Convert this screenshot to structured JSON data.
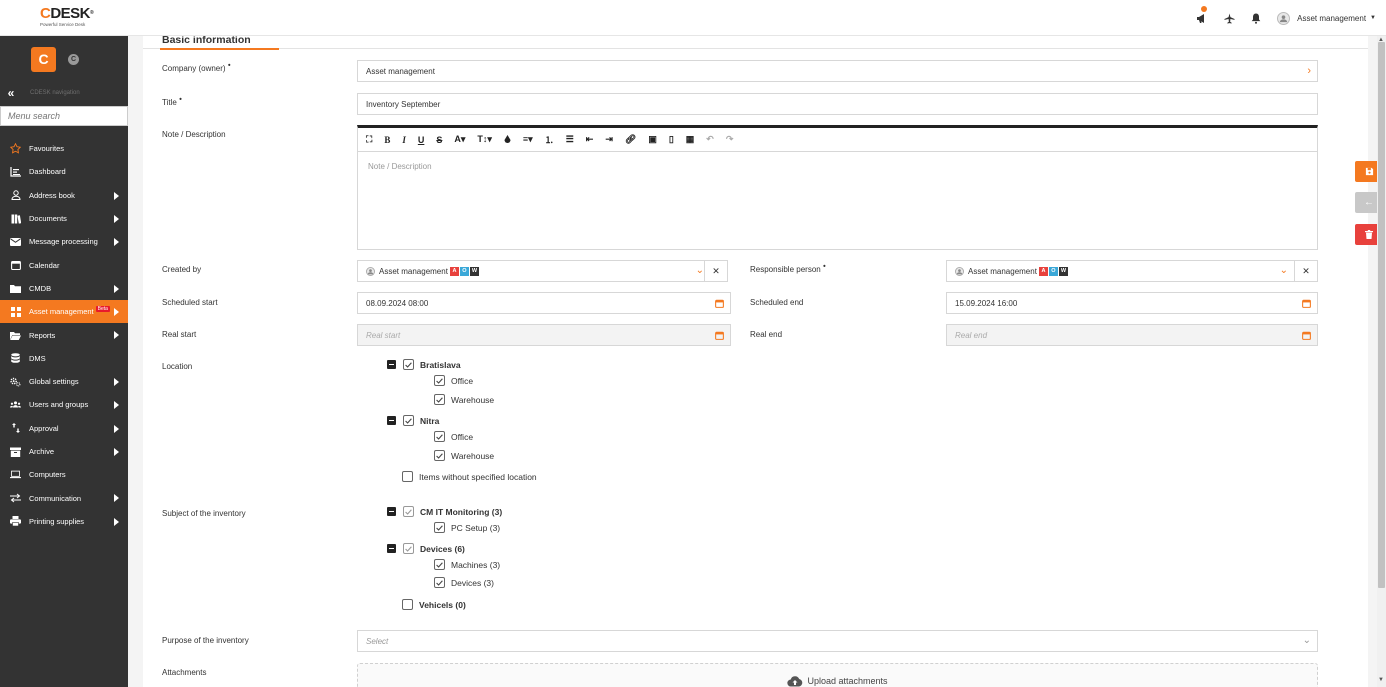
{
  "app": {
    "logo_text": "CDESK",
    "logo_sub": "Powerful Service Desk"
  },
  "topbar": {
    "user_name": "Asset management",
    "icons": [
      "megaphone-icon",
      "airplane-icon",
      "bell-icon",
      "user-avatar-icon"
    ]
  },
  "sidebar": {
    "nav_label": "CDESK navigation",
    "search_placeholder": "Menu search",
    "items": [
      {
        "label": "Favourites",
        "icon": "star-icon",
        "arrow": false
      },
      {
        "label": "Dashboard",
        "icon": "dashboard-icon",
        "arrow": false
      },
      {
        "label": "Address book",
        "icon": "person-icon",
        "arrow": true
      },
      {
        "label": "Documents",
        "icon": "books-icon",
        "arrow": true
      },
      {
        "label": "Message processing",
        "icon": "envelope-icon",
        "arrow": true
      },
      {
        "label": "Calendar",
        "icon": "calendar-icon",
        "arrow": false
      },
      {
        "label": "CMDB",
        "icon": "folder-icon",
        "arrow": true
      },
      {
        "label": "Asset management",
        "icon": "grid-icon",
        "arrow": true,
        "active": true,
        "badge": "Beta"
      },
      {
        "label": "Reports",
        "icon": "folder-open-icon",
        "arrow": true
      },
      {
        "label": "DMS",
        "icon": "database-icon",
        "arrow": false
      },
      {
        "label": "Global settings",
        "icon": "cogs-icon",
        "arrow": true
      },
      {
        "label": "Users and groups",
        "icon": "users-icon",
        "arrow": true
      },
      {
        "label": "Approval",
        "icon": "arrows-icon",
        "arrow": true
      },
      {
        "label": "Archive",
        "icon": "archive-icon",
        "arrow": true
      },
      {
        "label": "Computers",
        "icon": "laptop-icon",
        "arrow": false
      },
      {
        "label": "Communication",
        "icon": "exchange-icon",
        "arrow": true
      },
      {
        "label": "Printing supplies",
        "icon": "printer-icon",
        "arrow": true
      }
    ]
  },
  "form": {
    "section_title": "Basic information",
    "company_label": "Company (owner)",
    "company_value": "Asset management",
    "title_label": "Title",
    "title_value": "Inventory September",
    "note_label": "Note / Description",
    "note_placeholder": "Note / Description",
    "created_by_label": "Created by",
    "created_by_value": "Asset management",
    "responsible_label": "Responsible person",
    "responsible_value": "Asset management",
    "badges": [
      "A",
      "O",
      "W"
    ],
    "scheduled_start_label": "Scheduled start",
    "scheduled_start_value": "08.09.2024 08:00",
    "scheduled_end_label": "Scheduled end",
    "scheduled_end_value": "15.09.2024 16:00",
    "real_start_label": "Real start",
    "real_start_placeholder": "Real start",
    "real_end_label": "Real end",
    "real_end_placeholder": "Real end",
    "location_label": "Location",
    "location_tree": {
      "bratislava": "Bratislava",
      "bratislava_office": "Office",
      "bratislava_warehouse": "Warehouse",
      "nitra": "Nitra",
      "nitra_office": "Office",
      "nitra_warehouse": "Warehouse",
      "no_location": "Items without specified location"
    },
    "subject_label": "Subject of the inventory",
    "subject_tree": {
      "cm": "CM IT Monitoring (3)",
      "pc": "PC Setup (3)",
      "devices": "Devices (6)",
      "machines": "Machines (3)",
      "devices_sub": "Devices (3)",
      "vehicles": "Vehicels (0)"
    },
    "purpose_label": "Purpose of the inventory",
    "purpose_placeholder": "Select",
    "attachments_label": "Attachments",
    "upload_label": "Upload attachments"
  },
  "colors": {
    "accent": "#f47920",
    "danger": "#e8413c",
    "sidebar": "#333333"
  }
}
